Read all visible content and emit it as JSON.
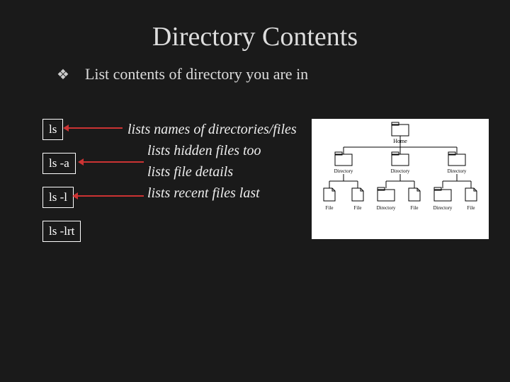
{
  "title": "Directory Contents",
  "subtitle": "List contents of directory you are in",
  "commands": {
    "c1": "ls",
    "c2": "ls -a",
    "c3": "ls -l",
    "c4": "ls -lrt"
  },
  "descriptions": {
    "d1": "lists names of directories/files",
    "d2": "lists hidden files too",
    "d3": "lists file details",
    "d4": "lists recent files last"
  },
  "diagram": {
    "root": "Home",
    "row2": [
      "Directory",
      "Directory",
      "Directory"
    ],
    "row3": [
      "File",
      "File",
      "Directory",
      "File",
      "Directory",
      "File"
    ]
  }
}
